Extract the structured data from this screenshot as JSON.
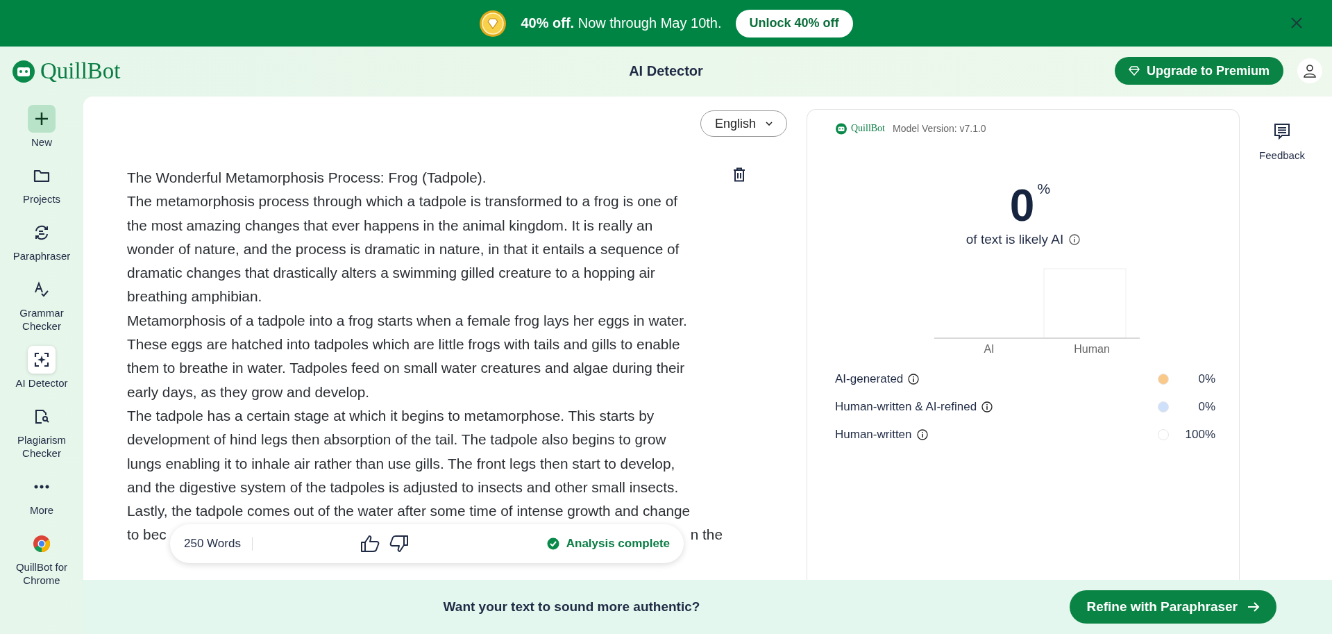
{
  "promo_banner": {
    "lead": "40% off.",
    "text": "Now through May 10th.",
    "button": "Unlock 40% off"
  },
  "header": {
    "logo": "QuillBot",
    "title": "AI Detector",
    "upgrade_button": "Upgrade to Premium"
  },
  "sidebar": {
    "items": [
      {
        "kind": "new",
        "label": "New",
        "selected": false
      },
      {
        "kind": "projects",
        "label": "Projects",
        "selected": false
      },
      {
        "kind": "paraphraser",
        "label": "Paraphraser",
        "selected": false
      },
      {
        "kind": "grammar",
        "label": "Grammar Checker",
        "selected": false
      },
      {
        "kind": "detector",
        "label": "AI Detector",
        "selected": true
      },
      {
        "kind": "plagiarism",
        "label": "Plagiarism Checker",
        "selected": false
      },
      {
        "kind": "more",
        "label": "More",
        "selected": false
      },
      {
        "kind": "chrome",
        "label": "QuillBot for Chrome",
        "selected": false
      }
    ]
  },
  "editor": {
    "language": "English",
    "lines": [
      "The Wonderful Metamorphosis Process: Frog (Tadpole).",
      "The metamorphosis process through which a tadpole is transformed to a frog is one of",
      "the most amazing changes that ever happens in the animal kingdom. It is really an",
      "wonder of nature, and the process is dramatic in nature, in that it entails a sequence of",
      "dramatic changes that drastically alters a swimming gilled creature to a hopping air",
      "breathing amphibian.",
      "Metamorphosis of a tadpole into a frog starts when a female frog lays her eggs in water.",
      "These eggs are hatched into tadpoles which are little frogs with tails and gills to enable",
      "them to breathe in water. Tadpoles feed on small water creatures and algae during their",
      "early days, as they grow and develop.",
      "The tadpole has a certain stage at which it begins to metamorphose. This starts by",
      "development of hind legs then absorption of the tail. The tadpole also begins to grow",
      "lungs enabling it to inhale air rather than use gills. The front legs then start to develop,",
      "and the digestive system of the tadpoles is adjusted to insects and other small insects.",
      "Lastly, the tadpole comes out of the water after some time of intense growth and change"
    ],
    "covered_line": {
      "start": "to bec",
      "end": "n the"
    },
    "toolbar": {
      "word_count": "250 Words",
      "status": "Analysis complete"
    }
  },
  "results": {
    "logo": "QuillBot",
    "model_version": "Model Version: v7.1.0",
    "score": "0",
    "score_unit": "%",
    "score_caption": "of text is likely AI",
    "chart_labels": [
      "AI",
      "Human"
    ],
    "breakdown": [
      {
        "label": "AI-generated",
        "color": "#f9c98a",
        "value": "0%"
      },
      {
        "label": "Human-written & AI-refined",
        "color": "#cfe0fa",
        "value": "0%"
      },
      {
        "label": "Human-written",
        "color": "#ffffff",
        "value": "100%"
      }
    ]
  },
  "feedback": "Feedback",
  "footer": {
    "prompt": "Want your text to sound more authentic?",
    "button": "Refine with Paraphraser"
  }
}
